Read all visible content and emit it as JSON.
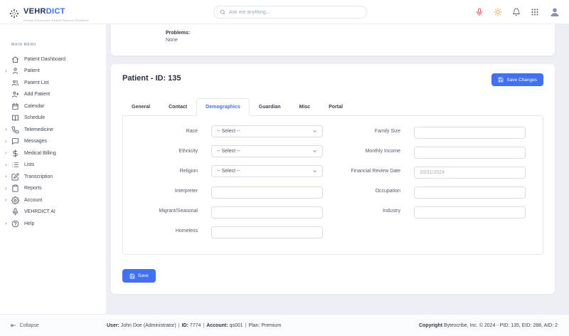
{
  "topbar": {
    "logo": {
      "brand_primary": "VEHR",
      "brand_secondary": "DICT",
      "tagline": "Virtual Electronic Health Record Dictation"
    },
    "search": {
      "placeholder": "Ask me anything..."
    },
    "icon_names": [
      "microphone-icon",
      "sun-icon",
      "bell-icon",
      "grid-icon",
      "avatar"
    ]
  },
  "sidebar": {
    "section_label": "MAIN MENU",
    "items": [
      {
        "label": "Patient Dashboard",
        "icon": "home-icon",
        "expandable": false
      },
      {
        "label": "Patient",
        "icon": "user-icon",
        "expandable": true
      },
      {
        "label": "Patient List",
        "icon": "users-icon",
        "expandable": false
      },
      {
        "label": "Add Patient",
        "icon": "user-plus-icon",
        "expandable": false
      },
      {
        "label": "Calendar",
        "icon": "calendar-icon",
        "expandable": false
      },
      {
        "label": "Schedule",
        "icon": "book-icon",
        "expandable": false
      },
      {
        "label": "Telemedicine",
        "icon": "phone-icon",
        "expandable": true
      },
      {
        "label": "Messages",
        "icon": "chat-icon",
        "expandable": true
      },
      {
        "label": "Medical Billing",
        "icon": "dollar-icon",
        "expandable": true
      },
      {
        "label": "Lists",
        "icon": "list-icon",
        "expandable": true
      },
      {
        "label": "Transcription",
        "icon": "pen-icon",
        "expandable": true
      },
      {
        "label": "Reports",
        "icon": "clipboard-icon",
        "expandable": true
      },
      {
        "label": "Account",
        "icon": "gear-icon",
        "expandable": true
      },
      {
        "label": "VEHRDICT AI",
        "icon": "mic-icon",
        "expandable": false
      },
      {
        "label": "Help",
        "icon": "help-icon",
        "expandable": true
      }
    ]
  },
  "problems_card": {
    "label": "Problems:",
    "value": "None"
  },
  "patient_card": {
    "title": "Patient - ID: 135",
    "save_changes_label": "Save Changes",
    "save_label": "Save",
    "tabs": [
      {
        "label": "General",
        "active": false
      },
      {
        "label": "Contact",
        "active": false
      },
      {
        "label": "Demographics",
        "active": true
      },
      {
        "label": "Guardian",
        "active": false
      },
      {
        "label": "Misc",
        "active": false
      },
      {
        "label": "Portal",
        "active": false
      }
    ],
    "form": {
      "left": [
        {
          "label": "Race",
          "type": "select",
          "value": "-- Select --"
        },
        {
          "label": "Ethnicity",
          "type": "select",
          "value": "-- Select --"
        },
        {
          "label": "Religion",
          "type": "select",
          "value": "-- Select --"
        },
        {
          "label": "Interpreter",
          "type": "text",
          "value": ""
        },
        {
          "label": "Migrant/Seasonal",
          "type": "text",
          "value": ""
        },
        {
          "label": "Homeless",
          "type": "text",
          "value": ""
        }
      ],
      "right": [
        {
          "label": "Family Size",
          "type": "text",
          "value": ""
        },
        {
          "label": "Monthly Income",
          "type": "text",
          "value": ""
        },
        {
          "label": "Financial Review Date",
          "type": "date",
          "placeholder": "10/31/2024"
        },
        {
          "label": "Occupation",
          "type": "text",
          "value": ""
        },
        {
          "label": "Industry",
          "type": "text",
          "value": ""
        }
      ]
    }
  },
  "footer": {
    "collapse_label": "Collapse",
    "user_label": "User:",
    "user_value": "John Doe (Administrator)",
    "id_label": "ID:",
    "id_value": "7774",
    "account_label": "Account:",
    "account_value": "qs001",
    "plan_label": "Plan:",
    "plan_value": "Premium",
    "separator": "|",
    "copyright_label": "Copyright",
    "copyright_text": "Bytescribe, Inc. © 2024 - PID: 135, EID: 288, AID: 2"
  },
  "colors": {
    "accent": "#4170f1",
    "mic": "#e05b5b",
    "sun": "#f0a24a",
    "background": "#edeff4"
  }
}
